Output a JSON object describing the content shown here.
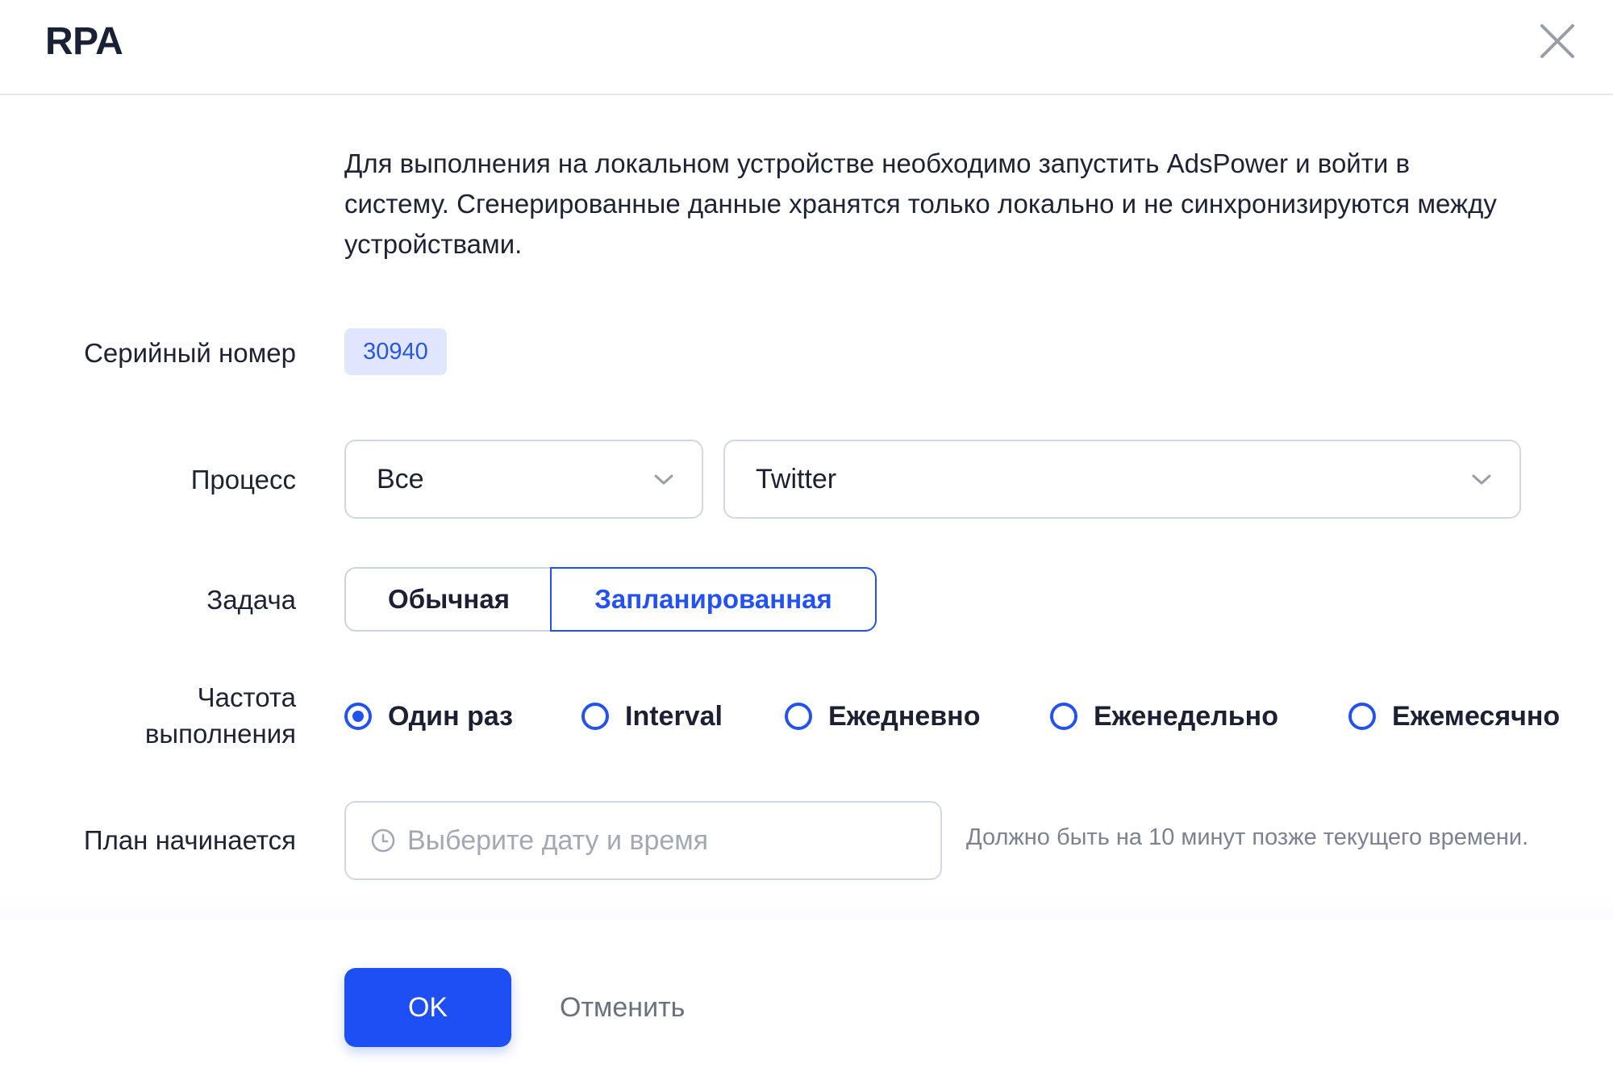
{
  "dialog": {
    "title": "RPA",
    "close_icon": "close-icon"
  },
  "description": "Для выполнения на локальном устройстве необходимо запустить AdsPower и войти в систему. Сгенерированные данные хранятся только локально и не синхронизируются между устройствами.",
  "serial": {
    "label": "Серийный номер",
    "value": "30940"
  },
  "process": {
    "label": "Процесс",
    "group_value": "Все",
    "flow_value": "Twitter",
    "chevron_icon": "chevron-down-icon"
  },
  "task": {
    "label": "Задача",
    "options": [
      "Обычная",
      "Запланированная"
    ],
    "selected": "Запланированная"
  },
  "frequency": {
    "label_line1": "Частота",
    "label_line2": "выполнения",
    "options": [
      "Один раз",
      "Interval",
      "Ежедневно",
      "Еженедельно",
      "Ежемесячно"
    ],
    "selected": "Один раз"
  },
  "plan": {
    "label": "План начинается",
    "placeholder": "Выберите дату и время",
    "hint": "Должно быть на 10 минут позже текущего времени.",
    "clock_icon": "clock-icon"
  },
  "footer": {
    "ok_label": "OK",
    "cancel_label": "Отменить"
  },
  "colors": {
    "accent": "#1e4ff5",
    "tag_bg": "#dfe6fd",
    "border": "#d4d7df"
  }
}
